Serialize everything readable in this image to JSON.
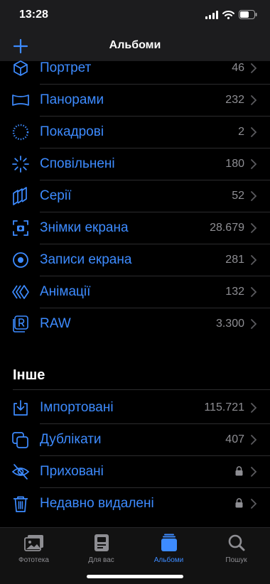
{
  "status": {
    "time": "13:28"
  },
  "header": {
    "title": "Альбоми"
  },
  "media_types": [
    {
      "label": "Портрет",
      "count": "46",
      "icon": "cube-icon"
    },
    {
      "label": "Панорами",
      "count": "232",
      "icon": "panorama-icon"
    },
    {
      "label": "Покадрові",
      "count": "2",
      "icon": "timelapse-icon"
    },
    {
      "label": "Сповільнені",
      "count": "180",
      "icon": "slowmo-icon"
    },
    {
      "label": "Серії",
      "count": "52",
      "icon": "bursts-icon"
    },
    {
      "label": "Знімки екрана",
      "count": "28.679",
      "icon": "screenshot-icon"
    },
    {
      "label": "Записи екрана",
      "count": "281",
      "icon": "screen-recording-icon"
    },
    {
      "label": "Анімації",
      "count": "132",
      "icon": "animated-icon"
    },
    {
      "label": "RAW",
      "count": "3.300",
      "icon": "raw-icon"
    }
  ],
  "other": {
    "title": "Інше",
    "items": [
      {
        "label": "Імпортовані",
        "count": "115.721",
        "icon": "import-icon"
      },
      {
        "label": "Дублікати",
        "count": "407",
        "icon": "duplicates-icon"
      },
      {
        "label": "Приховані",
        "count": "",
        "icon": "hidden-eye-icon",
        "locked": true
      },
      {
        "label": "Недавно видалені",
        "count": "",
        "icon": "trash-icon",
        "locked": true
      }
    ]
  },
  "tabs": [
    {
      "label": "Фототека",
      "icon": "photos-icon",
      "active": false
    },
    {
      "label": "Для вас",
      "icon": "for-you-icon",
      "active": false
    },
    {
      "label": "Альбоми",
      "icon": "albums-icon",
      "active": true
    },
    {
      "label": "Пошук",
      "icon": "search-icon",
      "active": false
    }
  ],
  "colors": {
    "accent": "#3d8bff",
    "background": "#000000",
    "bar": "#1c1c1e",
    "secondary": "#8e8e93"
  }
}
